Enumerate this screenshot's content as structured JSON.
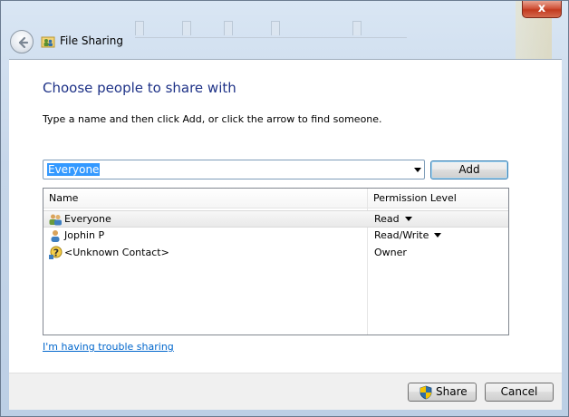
{
  "window": {
    "title": "File Sharing",
    "close_glyph": "x"
  },
  "dialog": {
    "heading": "Choose people to share with",
    "instruction": "Type a name and then click Add, or click the arrow to find someone."
  },
  "name_input": {
    "value": "Everyone"
  },
  "add_button": "Add",
  "table": {
    "columns": [
      "Name",
      "Permission Level"
    ],
    "rows": [
      {
        "name": "Everyone",
        "permission": "Read",
        "has_dropdown": true,
        "icon": "group-icon",
        "selected": true
      },
      {
        "name": "Jophin P",
        "permission": "Read/Write",
        "has_dropdown": true,
        "icon": "user-icon",
        "selected": false
      },
      {
        "name": "<Unknown Contact>",
        "permission": "Owner",
        "has_dropdown": false,
        "icon": "unknown-contact-icon",
        "selected": false
      }
    ]
  },
  "trouble_link": "I'm having trouble sharing",
  "footer": {
    "share_label": "Share",
    "cancel_label": "Cancel"
  },
  "colors": {
    "heading": "#1e3287",
    "link": "#0066cc",
    "selection": "#3399ff"
  }
}
